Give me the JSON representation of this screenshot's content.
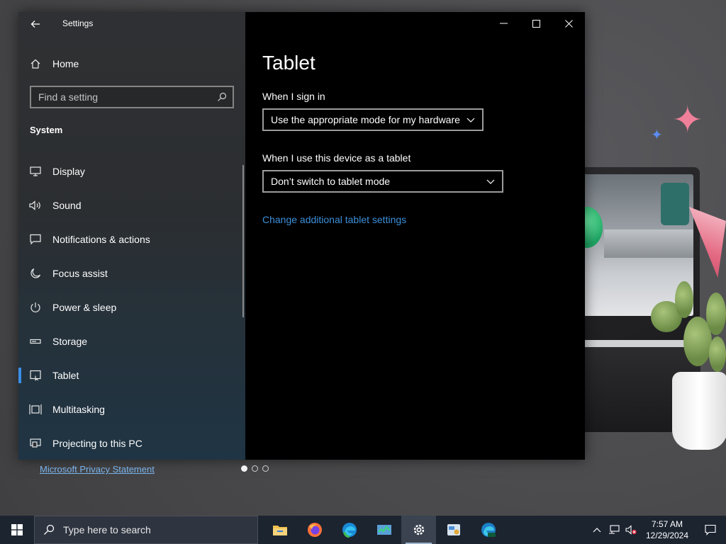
{
  "window": {
    "app_title": "Settings",
    "nav": {
      "home_label": "Home",
      "search_placeholder": "Find a setting",
      "section_label": "System",
      "items": [
        {
          "label": "Display",
          "icon": "monitor-icon",
          "active": false
        },
        {
          "label": "Sound",
          "icon": "speaker-icon",
          "active": false
        },
        {
          "label": "Notifications & actions",
          "icon": "message-icon",
          "active": false
        },
        {
          "label": "Focus assist",
          "icon": "moon-icon",
          "active": false
        },
        {
          "label": "Power & sleep",
          "icon": "power-icon",
          "active": false
        },
        {
          "label": "Storage",
          "icon": "drive-icon",
          "active": false
        },
        {
          "label": "Tablet",
          "icon": "tablet-icon",
          "active": true
        },
        {
          "label": "Multitasking",
          "icon": "multitasking-icon",
          "active": false
        },
        {
          "label": "Projecting to this PC",
          "icon": "projector-icon",
          "active": false
        }
      ]
    },
    "content": {
      "page_title": "Tablet",
      "sign_in_label": "When I sign in",
      "sign_in_value": "Use the appropriate mode for my hardware",
      "tablet_use_label": "When I use this device as a tablet",
      "tablet_use_value": "Don’t switch to tablet mode",
      "additional_link": "Change additional tablet settings"
    }
  },
  "desktop": {
    "privacy_link": "Microsoft Privacy Statement",
    "slide_dots": 3,
    "active_dot": 0
  },
  "taskbar": {
    "search_placeholder": "Type here to search",
    "apps": [
      "file-explorer-icon",
      "firefox-icon",
      "edge-icon",
      "task-manager-icon",
      "settings-icon",
      "control-panel-icon",
      "edge-beta-icon"
    ],
    "active_app": "settings-icon",
    "time": "7:57 AM",
    "date": "12/29/2024"
  },
  "colors": {
    "accent": "#3a8ee6",
    "link": "#3b8fd9",
    "taskbar": "#1c2430"
  }
}
